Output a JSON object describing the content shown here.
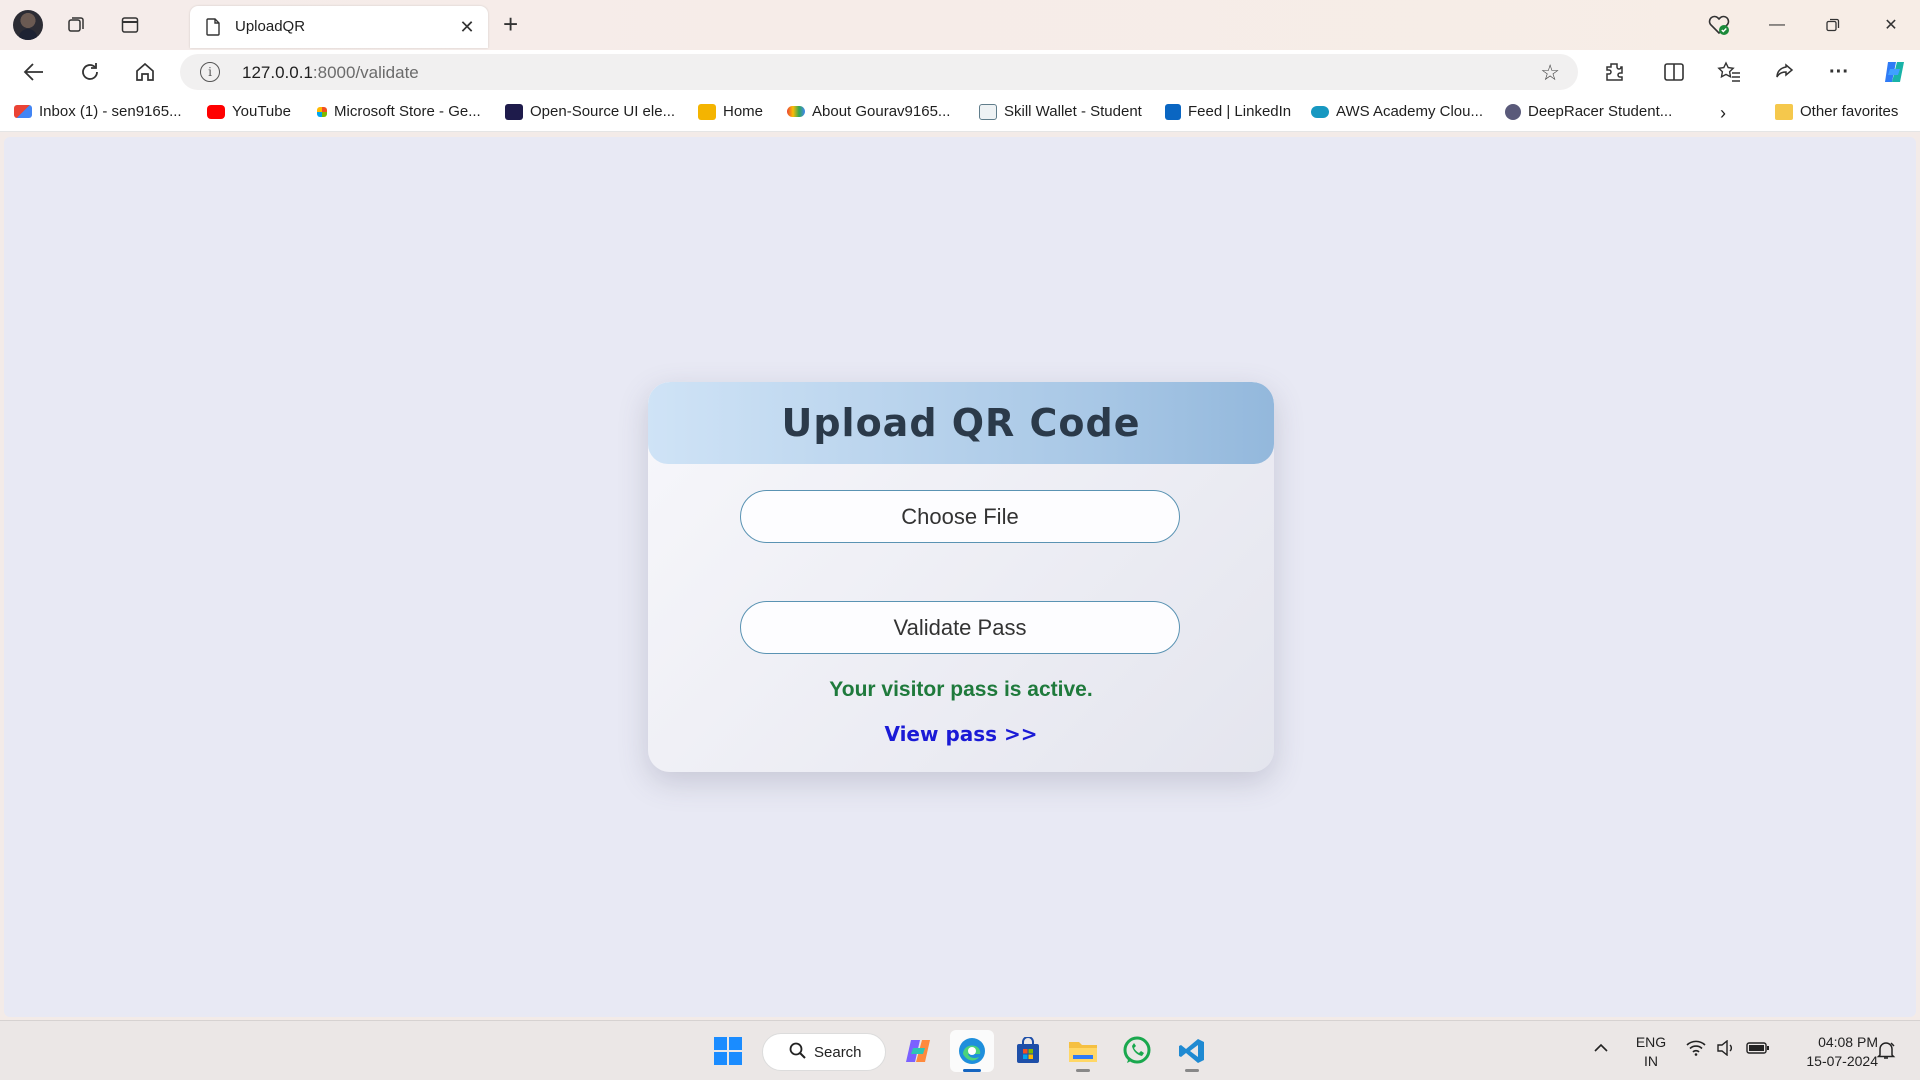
{
  "browser": {
    "tab_title": "UploadQR",
    "url_host": "127.0.0.1",
    "url_path": ":8000/validate",
    "favorites": [
      {
        "label": "Inbox (1) - sen9165...",
        "icon": "gmail-icon",
        "color": "#ea4335"
      },
      {
        "label": "YouTube",
        "icon": "youtube-icon",
        "color": "#ff0000"
      },
      {
        "label": "Microsoft Store - Ge...",
        "icon": "microsoft-store-icon",
        "color": "#f25022"
      },
      {
        "label": "Open-Source UI ele...",
        "icon": "uiverse-icon",
        "color": "#1e1b4b"
      },
      {
        "label": "Home",
        "icon": "classroom-icon",
        "color": "#f4b400"
      },
      {
        "label": "About Gourav9165...",
        "icon": "google-cloud-icon",
        "color": "#4285f4"
      },
      {
        "label": "Skill Wallet - Student",
        "icon": "skill-wallet-icon",
        "color": "#607d8b"
      },
      {
        "label": "Feed | LinkedIn",
        "icon": "linkedin-icon",
        "color": "#0a66c2"
      },
      {
        "label": "AWS Academy Clou...",
        "icon": "salesforce-cloud-icon",
        "color": "#1798c1"
      },
      {
        "label": "DeepRacer Student...",
        "icon": "deepracer-icon",
        "color": "#5a5a7a"
      }
    ],
    "other_favorites": "Other favorites"
  },
  "page": {
    "title": "Upload QR Code",
    "choose_file_label": "Choose File",
    "validate_label": "Validate Pass",
    "status_message": "Your visitor pass is active.",
    "view_link": "View pass >>",
    "colors": {
      "status": "#1f7a3c",
      "link": "#1a1ad6",
      "header": "#a9c8e6",
      "background": "#e8e9f4"
    }
  },
  "taskbar": {
    "search_label": "Search",
    "language": "ENG",
    "region": "IN",
    "time": "04:08 PM",
    "date": "15-07-2024"
  }
}
